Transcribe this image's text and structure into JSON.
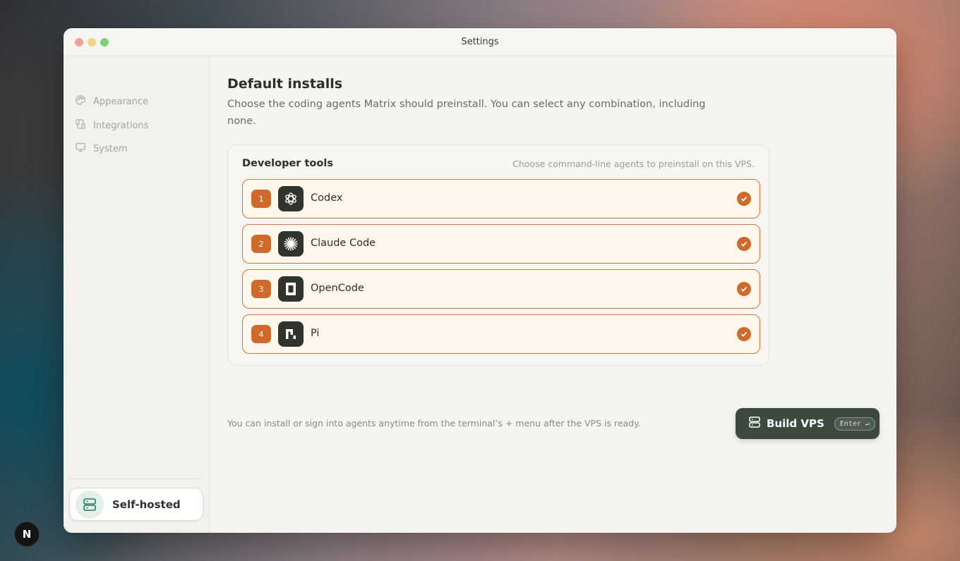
{
  "window": {
    "title": "Settings"
  },
  "sidebar": {
    "items": [
      {
        "label": "Appearance",
        "icon": "palette-icon"
      },
      {
        "label": "Integrations",
        "icon": "integrations-icon"
      },
      {
        "label": "System",
        "icon": "monitor-icon"
      }
    ],
    "footer": {
      "label": "Self-hosted",
      "icon": "server-icon"
    }
  },
  "main": {
    "title": "Default installs",
    "description": "Choose the coding agents Matrix should preinstall. You can select any combination, including none.",
    "card": {
      "title": "Developer tools",
      "hint": "Choose command-line agents to preinstall on this VPS.",
      "tools": [
        {
          "number": "1",
          "name": "Codex",
          "icon": "openai-icon",
          "checked": true
        },
        {
          "number": "2",
          "name": "Claude Code",
          "icon": "claude-icon",
          "checked": true
        },
        {
          "number": "3",
          "name": "OpenCode",
          "icon": "opencode-icon",
          "checked": true
        },
        {
          "number": "4",
          "name": "Pi",
          "icon": "pi-icon",
          "checked": true
        }
      ]
    },
    "footnote": "You can install or sign into agents anytime from the terminal’s + menu after the VPS is ready.",
    "build_button": {
      "label": "Build VPS",
      "shortcut": "Enter ↵",
      "icon": "server-icon"
    }
  },
  "dock_badge": "N",
  "colors": {
    "accent": "#d06a2b",
    "primary_button": "#3c4a3d",
    "tool_bg": "#fff6ec"
  }
}
